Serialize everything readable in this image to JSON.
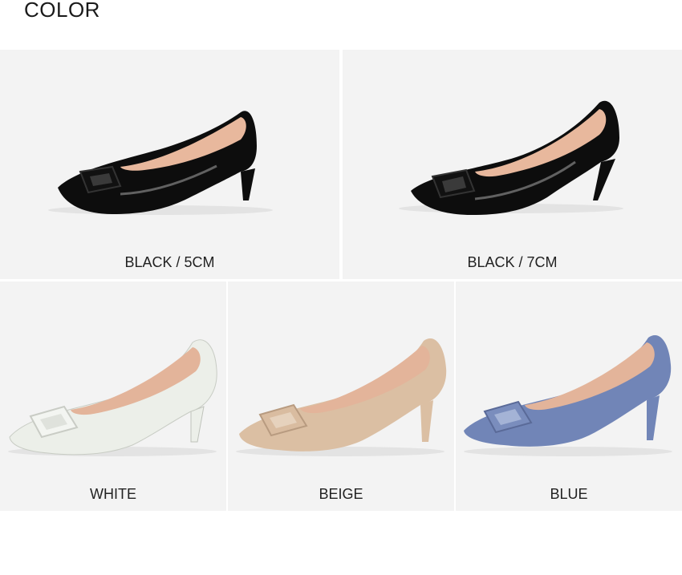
{
  "page": {
    "heading": "COLOR"
  },
  "products": [
    {
      "label": "BLACK / 5CM",
      "color": "#0d0d0d",
      "lining": "#e8b89d",
      "buckle": "#111111"
    },
    {
      "label": "BLACK / 7CM",
      "color": "#0d0d0d",
      "lining": "#e8b89d",
      "buckle": "#111111"
    },
    {
      "label": "WHITE",
      "color": "#ecefe9",
      "lining": "#e3b49a",
      "buckle": "#f3f5f1"
    },
    {
      "label": "BEIGE",
      "color": "#dbbfa3",
      "lining": "#e3b49a",
      "buckle": "#d9bca0"
    },
    {
      "label": "BLUE",
      "color": "#7185b7",
      "lining": "#e3b49a",
      "buckle": "#7a8dbd"
    }
  ]
}
